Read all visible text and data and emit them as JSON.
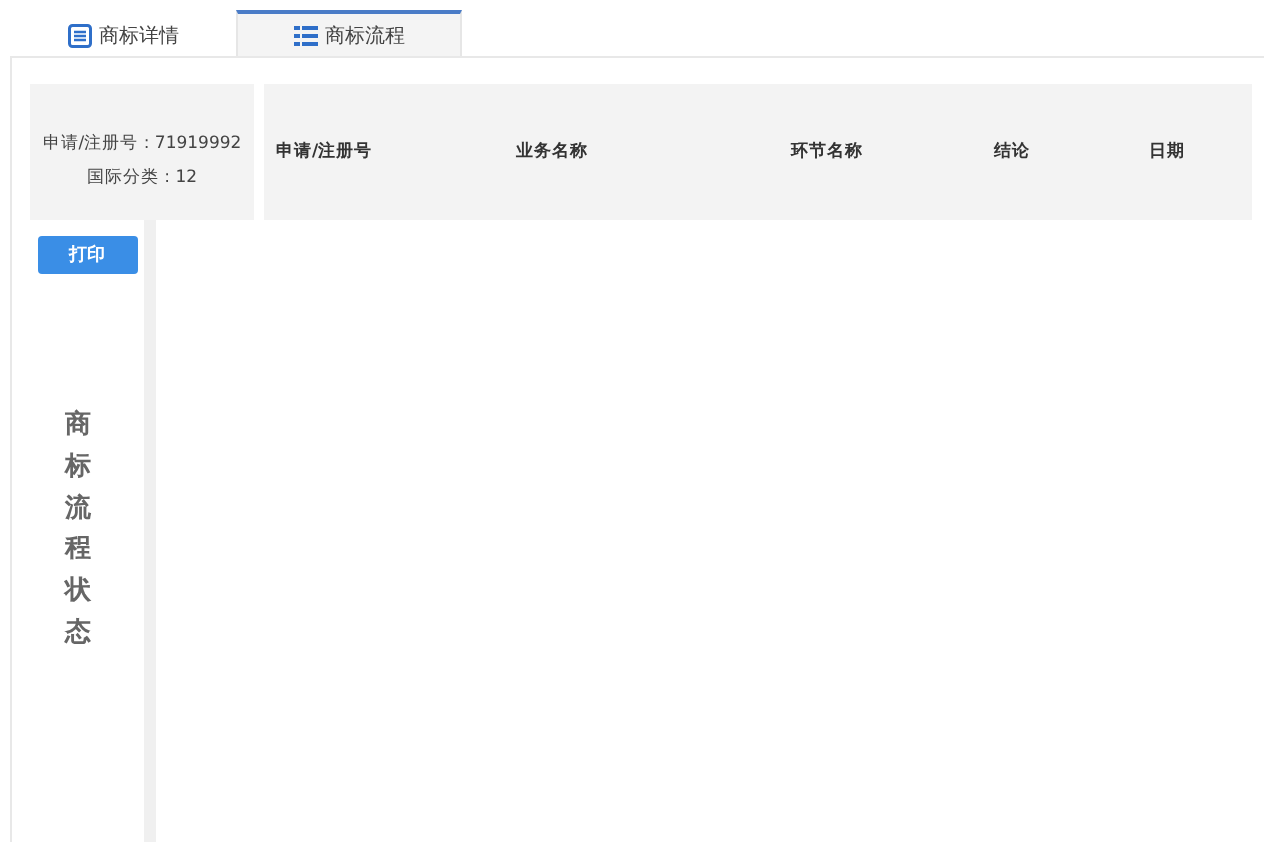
{
  "tabs": [
    {
      "label": "商标详情",
      "selected": false,
      "kind": "details"
    },
    {
      "label": "商标流程",
      "selected": true,
      "kind": "process"
    }
  ],
  "summary": {
    "registration": "申请/注册号 : 71919992",
    "class": "国际分类 : 12"
  },
  "table": {
    "columns": [
      "申请/注册号",
      "业务名称",
      "环节名称",
      "结论",
      "日期"
    ]
  },
  "print_button": "打印",
  "side_title": "商标流程状态"
}
